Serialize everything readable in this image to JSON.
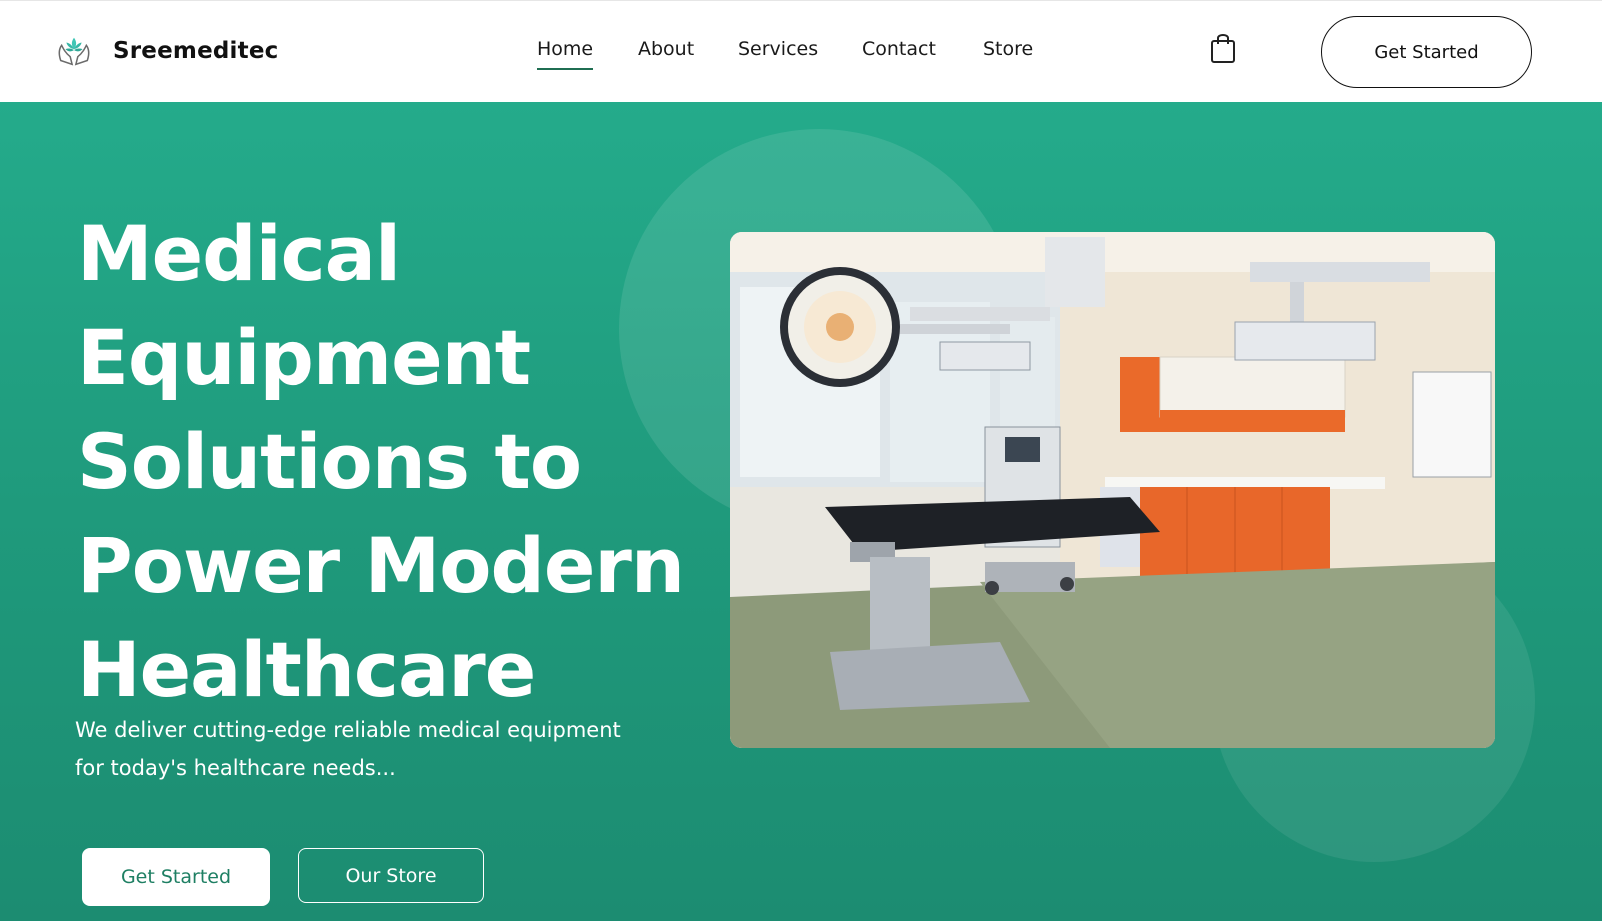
{
  "header": {
    "brand": "Sreemeditec",
    "nav": [
      {
        "label": "Home",
        "active": true
      },
      {
        "label": "About",
        "active": false
      },
      {
        "label": "Services",
        "active": false
      },
      {
        "label": "Contact",
        "active": false
      },
      {
        "label": "Store",
        "active": false
      }
    ],
    "cart_icon": "shopping-bag-icon",
    "logo_icon": "hands-lotus-icon",
    "cta_label": "Get Started"
  },
  "hero": {
    "headline_lines": [
      "Medical",
      "Equipment",
      "Solutions to",
      "Power Modern",
      "Healthcare"
    ],
    "subtext_lines": [
      "We deliver cutting-edge reliable medical equipment",
      "for today's healthcare needs..."
    ],
    "primary_button": "Get Started",
    "secondary_button": "Our Store",
    "image_subject": "operating-room-image"
  },
  "colors": {
    "hero_bg": "#22a283",
    "accent_text": "#1e7f63",
    "white": "#ffffff",
    "dark": "#111111"
  }
}
